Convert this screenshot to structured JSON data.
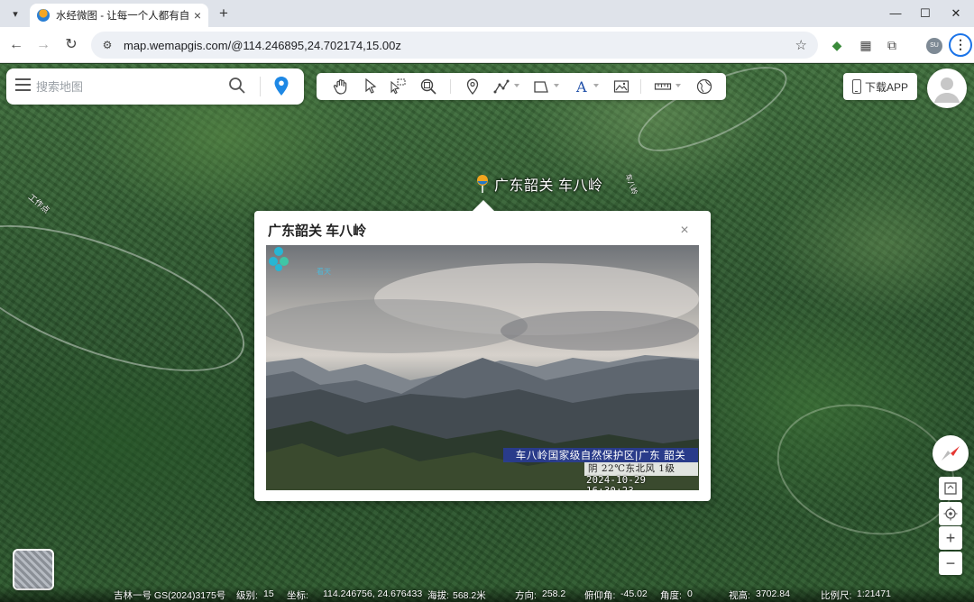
{
  "browser": {
    "tab_title": "水经微图 - 让每一个人都有自己",
    "tab_close": "×",
    "new_tab": "+",
    "url": "map.wemapgis.com/@114.246895,24.702174,15.00z",
    "profile_initials": "SU"
  },
  "search": {
    "placeholder": "搜索地图"
  },
  "header": {
    "download_label": "下载APP"
  },
  "place": {
    "name": "广东韶关 车八岭"
  },
  "popup": {
    "title": "广东韶关 车八岭",
    "close": "×",
    "camera": {
      "logo_text": "看天",
      "banner": "车八岭国家级自然保护区|广东 韶关",
      "weather": "阴 22℃东北风 1级",
      "timestamp": "2024-10-29 16:30:23"
    }
  },
  "map_labels": [
    "工作点",
    "车八岭"
  ],
  "controls": {
    "zoom_in": "+",
    "zoom_out": "−"
  },
  "status": {
    "source": "吉林一号 GS(2024)3175号",
    "level_label": "级别:",
    "level": "15",
    "coord_label": "坐标:",
    "coords": "114.246756, 24.676433",
    "elev_label": "海拔:",
    "elev": "568.2米",
    "heading_label": "方向:",
    "heading": "258.2",
    "pitch_label": "俯仰角:",
    "pitch": "-45.02",
    "roll_label": "角度:",
    "roll": "0",
    "view_label": "视高:",
    "view": "3702.84",
    "scale_label": "比例尺:",
    "scale": "1:21471"
  },
  "colors": {
    "accent": "#1a73e8",
    "pin": "#1e88e5",
    "osd_banner": "#283ca8"
  }
}
